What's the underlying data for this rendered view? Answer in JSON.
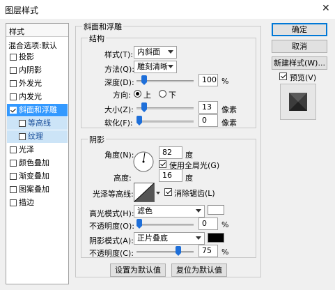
{
  "window": {
    "title": "图层样式",
    "close_glyph": "✕"
  },
  "left_panel": {
    "header": "样式",
    "blend_default": "混合选项:默认",
    "items": [
      {
        "label": "投影",
        "checked": false
      },
      {
        "label": "内阴影",
        "checked": false
      },
      {
        "label": "外发光",
        "checked": false
      },
      {
        "label": "内发光",
        "checked": false
      },
      {
        "label": "斜面和浮雕",
        "checked": true
      },
      {
        "label": "等高线",
        "checked": false
      },
      {
        "label": "纹理",
        "checked": false
      },
      {
        "label": "光泽",
        "checked": false
      },
      {
        "label": "颜色叠加",
        "checked": false
      },
      {
        "label": "渐变叠加",
        "checked": false
      },
      {
        "label": "图案叠加",
        "checked": false
      },
      {
        "label": "描边",
        "checked": false
      }
    ]
  },
  "bevel": {
    "title": "斜面和浮雕",
    "structure": {
      "title": "结构",
      "style_label": "样式(T):",
      "style_value": "内斜面",
      "technique_label": "方法(Q):",
      "technique_value": "雕刻清晰",
      "depth_label": "深度(D):",
      "depth_value": "100",
      "depth_unit": "%",
      "depth_level": 0.1,
      "direction_label": "方向:",
      "dir_up": "上",
      "dir_down": "下",
      "direction_selected": "上",
      "size_label": "大小(Z):",
      "size_value": "13",
      "size_unit": "像素",
      "size_level": 0.09,
      "soften_label": "软化(F):",
      "soften_value": "0",
      "soften_unit": "像素",
      "soften_level": 0.0
    },
    "shading": {
      "title": "阴影",
      "angle_label": "角度(N):",
      "angle_value": "82",
      "angle_unit": "度",
      "global_light_label": "使用全局光(G)",
      "global_light_checked": true,
      "altitude_label": "高度:",
      "altitude_value": "16",
      "altitude_unit": "度",
      "gloss_label": "光泽等高线:",
      "antialias_label": "消除锯齿(L)",
      "antialias_checked": true,
      "highlight_mode_label": "高光模式(H):",
      "highlight_mode_value": "滤色",
      "highlight_color": "#ffffff",
      "highlight_opacity_label": "不透明度(O):",
      "highlight_opacity_value": "0",
      "highlight_opacity_unit": "%",
      "highlight_opacity_level": 0.0,
      "shadow_mode_label": "阴影模式(A):",
      "shadow_mode_value": "正片叠底",
      "shadow_color": "#000000",
      "shadow_opacity_label": "不透明度(C):",
      "shadow_opacity_value": "75",
      "shadow_opacity_unit": "%",
      "shadow_opacity_level": 0.75
    },
    "set_default": "设置为默认值",
    "reset_default": "复位为默认值"
  },
  "right_panel": {
    "ok": "确定",
    "cancel": "取消",
    "new_style": "新建样式(W)...",
    "preview_label": "预览(V)",
    "preview_checked": true
  },
  "colors": {
    "accent": "#3399ff",
    "sub_item_bg": "#cce4f7",
    "slider_thumb": "#1e6fd9"
  }
}
